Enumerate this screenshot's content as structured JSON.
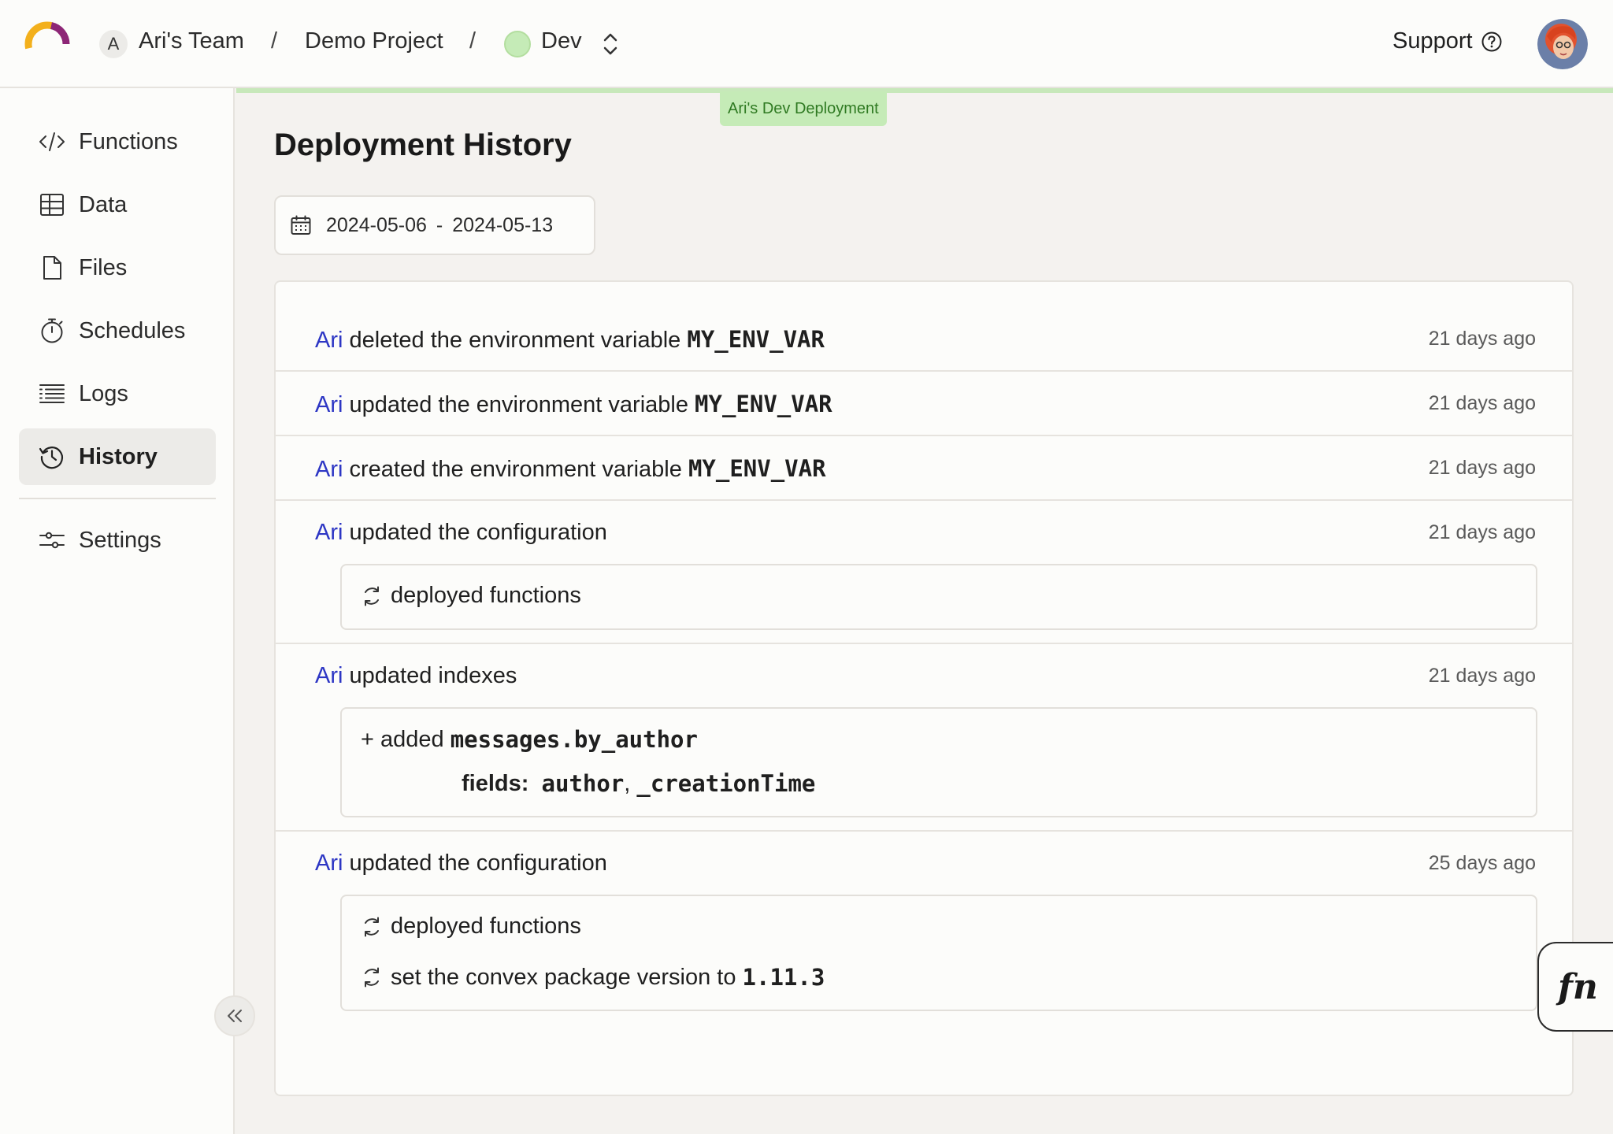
{
  "header": {
    "team_initial": "A",
    "team_name": "Ari's Team",
    "separator": "/",
    "project_name": "Demo Project",
    "deployment_name": "Dev",
    "support_label": "Support",
    "deployment_color": "#c5ebb7"
  },
  "sidebar": {
    "items": [
      {
        "label": "Functions",
        "icon": "code-icon"
      },
      {
        "label": "Data",
        "icon": "table-icon"
      },
      {
        "label": "Files",
        "icon": "file-icon"
      },
      {
        "label": "Schedules",
        "icon": "stopwatch-icon"
      },
      {
        "label": "Logs",
        "icon": "list-icon"
      },
      {
        "label": "History",
        "icon": "history-icon",
        "active": true
      },
      {
        "label": "Settings",
        "icon": "sliders-icon"
      }
    ]
  },
  "main": {
    "deployment_tag": "Ari's Dev Deployment",
    "title": "Deployment History",
    "date_range": {
      "start": "2024-05-06",
      "dash": "-",
      "end": "2024-05-13"
    },
    "entries": [
      {
        "actor": "Ari",
        "action": "deleted the environment variable",
        "target": "MY_ENV_VAR",
        "ago": "21 days ago"
      },
      {
        "actor": "Ari",
        "action": "updated the environment variable",
        "target": "MY_ENV_VAR",
        "ago": "21 days ago"
      },
      {
        "actor": "Ari",
        "action": "created the environment variable",
        "target": "MY_ENV_VAR",
        "ago": "21 days ago"
      },
      {
        "actor": "Ari",
        "action": "updated the configuration",
        "ago": "21 days ago",
        "details": [
          "deployed functions"
        ]
      },
      {
        "actor": "Ari",
        "action": "updated indexes",
        "ago": "21 days ago",
        "index": {
          "prefix": "+ added",
          "name": "messages.by_author",
          "fields_label": "fields:",
          "field1": "author",
          "comma": ",",
          "field2": "_creationTime"
        }
      },
      {
        "actor": "Ari",
        "action": "updated the configuration",
        "ago": "25 days ago",
        "details": [
          "deployed functions",
          "set the convex package version to"
        ],
        "version": "1.11.3"
      }
    ]
  },
  "fn_button": {
    "label": "fn"
  },
  "colors": {
    "actor": "#2d36c4",
    "accent_green": "#c5ebb7"
  }
}
